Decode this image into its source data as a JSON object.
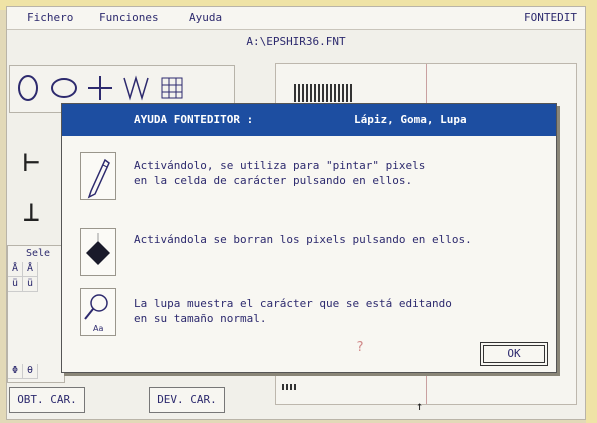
{
  "menubar": {
    "items": [
      "Fichero",
      "Funciones",
      "Ayuda"
    ],
    "app_name": "FONTEDIT"
  },
  "file_path": "A:\\EPSHIR36.FNT",
  "left_grid": {
    "header_label": "Sele",
    "cells": [
      "Å",
      "Å",
      "ü",
      "ü",
      "Φ",
      "θ"
    ]
  },
  "bottom_buttons": {
    "obtain": "OBT. CAR.",
    "return": "DEV. CAR."
  },
  "dialog": {
    "title_left": "AYUDA FONTEDITOR :",
    "title_right": "Lápiz, Goma, Lupa",
    "items": [
      {
        "icon": "pencil-icon",
        "line1": "Activándolo, se utiliza para \"pintar\" pixels",
        "line2": "en la celda de carácter pulsando en ellos."
      },
      {
        "icon": "eraser-icon",
        "line1": "Activándola se borran los pixels pulsando en ellos.",
        "line2": ""
      },
      {
        "icon": "magnifier-icon",
        "line1": "La lupa muestra el carácter que se está editando",
        "line2": "en su tamaño normal."
      }
    ],
    "help_mark": "?",
    "ok_label": "OK"
  },
  "colors": {
    "title_bar": "#1d4ea1",
    "text": "#2d2a6e"
  }
}
